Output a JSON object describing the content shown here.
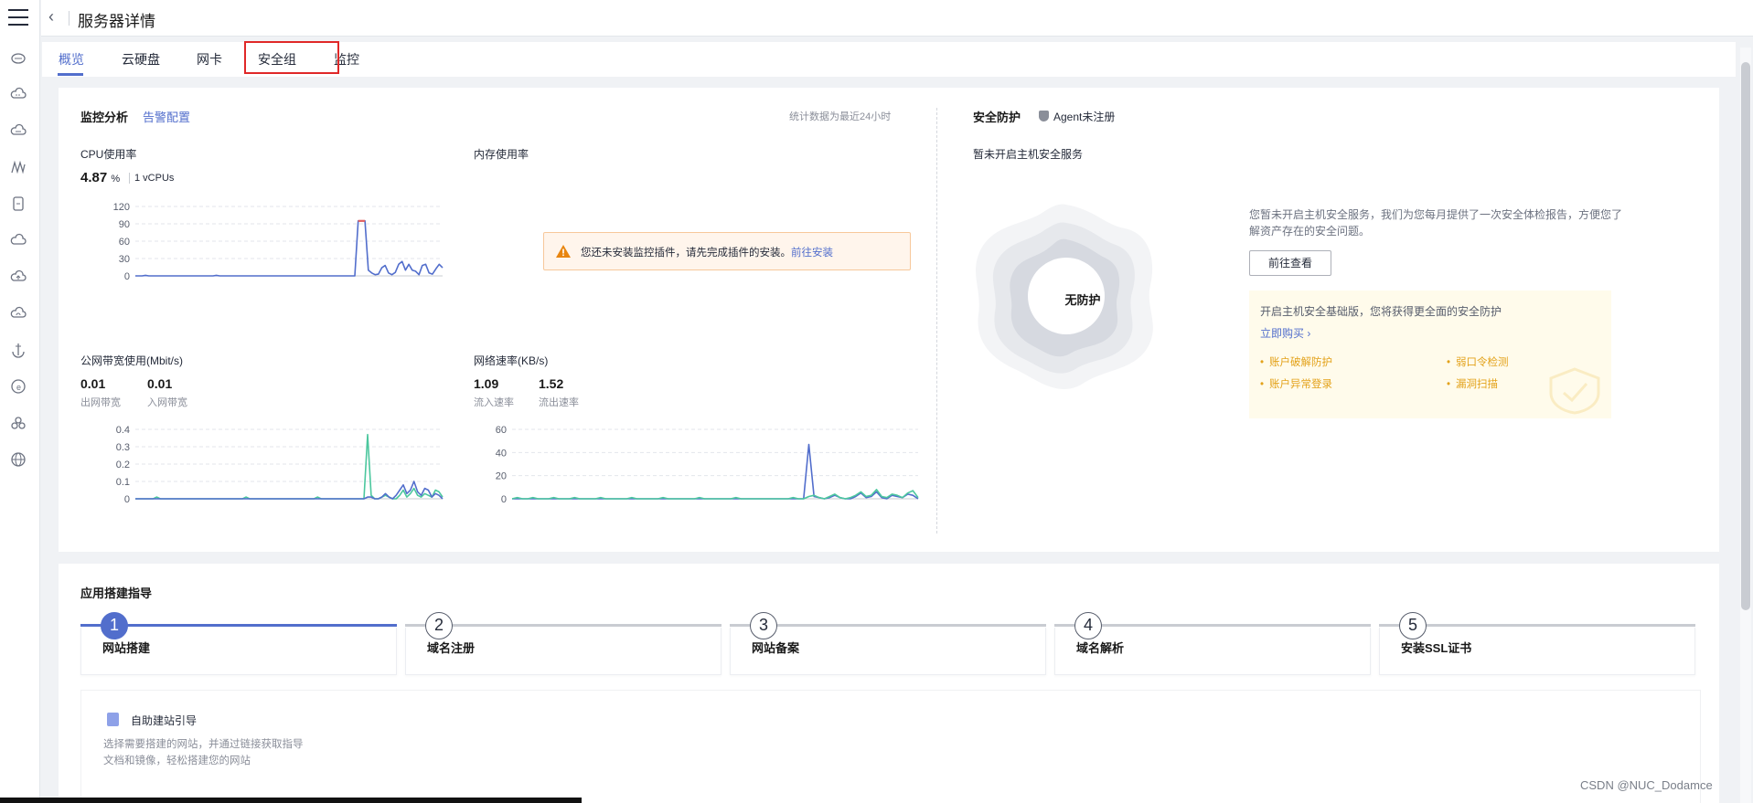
{
  "header": {
    "back_icon": "chevron-left",
    "title": "服务器详情"
  },
  "rail": {
    "icons": [
      "menu",
      "cloud-server",
      "cloud",
      "cloud-db",
      "graph",
      "document",
      "cloud-2",
      "cloud-upload",
      "cloud-sync",
      "anchor",
      "info-circle",
      "tree",
      "globe"
    ]
  },
  "tabs": [
    {
      "label": "概览",
      "active": true
    },
    {
      "label": "云硬盘"
    },
    {
      "label": "网卡"
    },
    {
      "label": "安全组",
      "highlighted": true
    },
    {
      "label": "监控"
    }
  ],
  "monitor": {
    "title": "监控分析",
    "alarm_link": "告警配置",
    "stats_note": "统计数据为最近24小时",
    "cpu": {
      "label": "CPU使用率",
      "value": "4.87",
      "unit": "%",
      "vcpu": "1 vCPUs"
    },
    "mem": {
      "label": "内存使用率",
      "warning": "您还未安装监控插件，请先完成插件的安装。",
      "warning_link": "前往安装"
    },
    "bandwidth": {
      "label": "公网带宽使用(Mbit/s)",
      "out_value": "0.01",
      "out_label": "出网带宽",
      "in_value": "0.01",
      "in_label": "入网带宽"
    },
    "netspeed": {
      "label": "网络速率(KB/s)",
      "in_value": "1.09",
      "in_label": "流入速率",
      "out_value": "1.52",
      "out_label": "流出速率"
    }
  },
  "chart_data": [
    {
      "type": "line",
      "title": "CPU使用率",
      "ylim": [
        0,
        120
      ],
      "yticks": [
        "120",
        "90",
        "60",
        "30",
        "0"
      ],
      "series": [
        {
          "color": "#526ecc",
          "peak_color": "#e26060",
          "values": [
            0,
            0,
            0,
            1,
            0,
            0,
            0,
            0,
            0,
            0,
            0,
            0,
            0,
            0,
            0,
            0,
            0,
            0,
            0,
            0,
            0,
            0,
            0,
            0,
            1,
            0,
            0,
            0,
            0,
            0,
            0,
            0,
            0,
            0,
            0,
            0,
            0,
            0,
            0,
            0,
            0,
            0,
            0,
            0,
            0,
            0,
            0,
            0,
            0,
            0,
            0,
            0,
            0,
            0,
            0,
            0,
            0,
            0,
            0,
            0,
            0,
            0,
            0,
            0,
            0,
            0,
            95,
            95,
            95,
            10,
            5,
            2,
            3,
            14,
            18,
            5,
            2,
            6,
            20,
            25,
            10,
            20,
            10,
            8,
            2,
            18,
            20,
            5,
            3,
            12,
            20,
            14
          ]
        }
      ]
    },
    {
      "type": "line",
      "title": "公网带宽使用(Mbit/s)",
      "ylim": [
        0,
        0.4
      ],
      "yticks": [
        "0.4",
        "0.3",
        "0.2",
        "0.1",
        "0"
      ],
      "series": [
        {
          "color": "#4cc79e",
          "values": [
            0,
            0,
            0,
            0,
            0,
            0,
            0.01,
            0,
            0,
            0,
            0,
            0,
            0,
            0,
            0,
            0,
            0,
            0,
            0,
            0,
            0,
            0,
            0,
            0,
            0,
            0,
            0,
            0,
            0,
            0,
            0,
            0.01,
            0,
            0,
            0,
            0,
            0,
            0,
            0,
            0,
            0,
            0,
            0,
            0,
            0,
            0,
            0,
            0,
            0,
            0,
            0,
            0.01,
            0,
            0,
            0,
            0,
            0,
            0,
            0,
            0,
            0,
            0,
            0,
            0,
            0,
            0.37,
            0.02,
            0,
            0,
            0.01,
            0.02,
            0.01,
            0,
            0,
            0.02,
            0.05,
            0.01,
            0.03,
            0.06,
            0.02,
            0.01,
            0.03,
            0.02,
            0.01,
            0.05,
            0.04,
            0.01
          ]
        },
        {
          "color": "#526ecc",
          "values": [
            0,
            0,
            0,
            0,
            0,
            0,
            0,
            0,
            0,
            0,
            0,
            0,
            0,
            0,
            0,
            0,
            0,
            0,
            0,
            0,
            0,
            0,
            0,
            0,
            0,
            0,
            0,
            0,
            0,
            0,
            0,
            0,
            0,
            0,
            0,
            0,
            0,
            0,
            0,
            0,
            0,
            0,
            0,
            0,
            0,
            0,
            0,
            0,
            0,
            0,
            0,
            0,
            0,
            0,
            0,
            0,
            0,
            0,
            0,
            0,
            0,
            0,
            0,
            0,
            0,
            0.01,
            0.01,
            0,
            0,
            0.01,
            0.03,
            0.01,
            0,
            0.02,
            0.05,
            0.08,
            0.03,
            0.05,
            0.1,
            0.04,
            0.02,
            0.06,
            0.05,
            0.01,
            0.03,
            0.02,
            0
          ]
        }
      ]
    },
    {
      "type": "line",
      "title": "网络速率(KB/s)",
      "ylim": [
        0,
        60
      ],
      "yticks": [
        "60",
        "40",
        "20",
        "0"
      ],
      "series": [
        {
          "color": "#526ecc",
          "values": [
            0,
            0,
            0,
            0,
            0,
            0,
            0,
            0,
            0,
            0,
            0,
            0,
            0,
            0,
            0,
            0,
            0,
            0,
            0,
            0,
            0,
            0,
            0,
            0,
            0,
            0,
            0,
            0,
            0,
            0,
            0,
            0,
            0,
            0,
            0,
            0,
            0,
            0,
            0,
            0,
            0,
            0,
            0,
            0,
            0,
            0,
            0,
            0,
            0,
            0,
            0,
            0,
            0,
            0,
            0,
            0,
            0,
            47,
            2,
            1,
            0,
            1,
            3,
            1,
            0,
            0,
            2,
            5,
            1,
            2,
            6,
            1,
            0,
            3,
            2,
            1,
            4,
            3,
            0
          ]
        },
        {
          "color": "#4cc79e",
          "values": [
            0,
            1,
            0,
            0,
            1,
            0,
            0,
            0,
            1,
            0,
            0,
            0,
            1,
            0,
            0,
            0,
            0,
            1,
            0,
            0,
            0,
            0,
            0,
            1,
            0,
            0,
            0,
            0,
            0,
            1,
            0,
            0,
            0,
            0,
            0,
            0,
            1,
            0,
            0,
            0,
            0,
            0,
            0,
            1,
            0,
            0,
            0,
            0,
            0,
            0,
            0,
            0,
            0,
            0,
            1,
            0,
            0,
            2,
            3,
            1,
            0,
            2,
            4,
            1,
            0,
            1,
            3,
            6,
            2,
            3,
            8,
            2,
            1,
            4,
            3,
            1,
            5,
            7,
            1
          ]
        }
      ]
    }
  ],
  "security": {
    "title": "安全防护",
    "agent_status": "Agent未注册",
    "notice": "暂未开启主机安全服务",
    "status_label": "无防护",
    "desc": "您暂未开启主机安全服务，我们为您每月提供了一次安全体检报告，方便您了解资产存在的安全问题。",
    "view_button": "前往查看",
    "promo_title": "开启主机安全基础版，您将获得更全面的安全防护",
    "promo_link": "立即购买 ›",
    "features": [
      "账户破解防护",
      "弱口令检测",
      "账户异常登录",
      "漏洞扫描"
    ]
  },
  "guide": {
    "title": "应用搭建指导",
    "steps": [
      {
        "num": "1",
        "label": "网站搭建",
        "active": true
      },
      {
        "num": "2",
        "label": "域名注册"
      },
      {
        "num": "3",
        "label": "网站备案"
      },
      {
        "num": "4",
        "label": "域名解析"
      },
      {
        "num": "5",
        "label": "安装SSL证书"
      }
    ],
    "panel_title": "自助建站引导",
    "panel_desc1": "选择需要搭建的网站，并通过链接获取指导",
    "panel_desc2": "文档和镜像，轻松搭建您的网站"
  },
  "watermark": "CSDN @NUC_Dodamce",
  "colors": {
    "accent": "#526ecc",
    "green": "#4cc79e",
    "warn": "#e8850f",
    "danger": "#e02828"
  }
}
